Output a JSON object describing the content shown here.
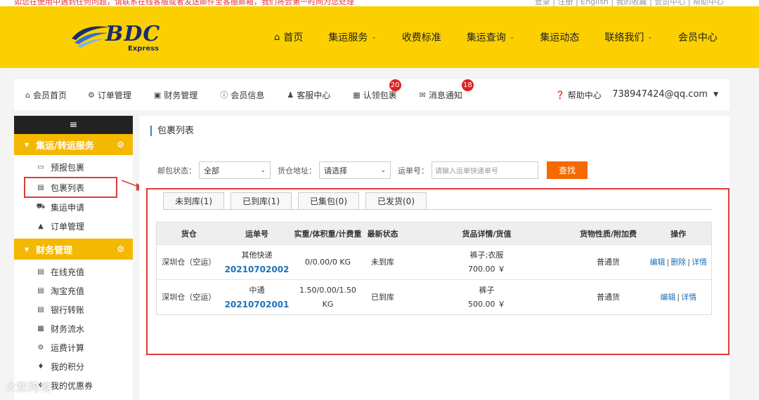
{
  "top_strip": {
    "left_text": "如您在使用中遇到任何问题，请联系在线客服或者发送邮件至客服邮箱，我们将会第一时间为您处理",
    "right_text": "登录 | 注册 | English | 我的收藏 | 会员中心 | 帮助中心"
  },
  "header": {
    "logo_text": "BDC",
    "logo_sub": "Express",
    "nav": [
      {
        "label": "首页",
        "has_menu": false
      },
      {
        "label": "集运服务",
        "has_menu": true
      },
      {
        "label": "收费标准",
        "has_menu": false
      },
      {
        "label": "集运查询",
        "has_menu": true
      },
      {
        "label": "集运动态",
        "has_menu": false
      },
      {
        "label": "联络我们",
        "has_menu": true
      },
      {
        "label": "会员中心",
        "has_menu": false
      }
    ]
  },
  "member_nav": {
    "items": [
      {
        "label": "会员首页",
        "icon": "home-icon"
      },
      {
        "label": "订单管理",
        "icon": "gear-icon"
      },
      {
        "label": "财务管理",
        "icon": "money-icon"
      },
      {
        "label": "会员信息",
        "icon": "info-icon"
      },
      {
        "label": "客服中心",
        "icon": "user-icon"
      },
      {
        "label": "认领包裹",
        "icon": "package-icon",
        "badge": "20"
      },
      {
        "label": "消息通知",
        "icon": "mail-icon",
        "badge": "18"
      }
    ],
    "help": "帮助中心",
    "user": "738947424@qq.com"
  },
  "sidebar": {
    "toggle": "≡",
    "groups": [
      {
        "title": "集运/转运服务",
        "items": [
          {
            "label": "预报包裹",
            "icon": "forecast-icon"
          },
          {
            "label": "包裹列表",
            "icon": "list-icon",
            "active": true
          },
          {
            "label": "集运申请",
            "icon": "truck-icon"
          },
          {
            "label": "订单管理",
            "icon": "book-icon"
          }
        ]
      },
      {
        "title": "财务管理",
        "items": [
          {
            "label": "在线充值",
            "icon": "list-icon"
          },
          {
            "label": "淘宝充值",
            "icon": "card-icon"
          },
          {
            "label": "银行转账",
            "icon": "card-icon"
          },
          {
            "label": "财务流水",
            "icon": "chart-icon"
          },
          {
            "label": "运费计算",
            "icon": "gears-icon"
          },
          {
            "label": "我的积分",
            "icon": "gift-icon"
          },
          {
            "label": "我的优惠券",
            "icon": "gift-icon"
          }
        ]
      }
    ]
  },
  "main": {
    "title": "包裹列表",
    "filters": {
      "status_label": "邮包状态：",
      "status_value": "全部",
      "warehouse_label": "货仓地址：",
      "warehouse_value": "请选择",
      "waybill_label": "运单号：",
      "waybill_placeholder": "请输入运单快递单号",
      "search_button": "查找"
    },
    "tabs": [
      "未到库(1)",
      "已到库(1)",
      "已集包(0)",
      "已发货(0)"
    ],
    "table": {
      "headers": [
        "货仓",
        "运单号",
        "实重/体积重/计费重",
        "最新状态",
        "货品详情/货值",
        "货物性质/附加费",
        "操作"
      ],
      "rows": [
        {
          "warehouse": "深圳仓（空运）",
          "carrier": "其他快递",
          "waybill": "20210702002",
          "weight": "0/0.00/0 KG",
          "status": "未到库",
          "goods": "裤子;衣服",
          "value": "700.00 ￥",
          "nature": "普通货",
          "actions": [
            "编辑",
            "删除",
            "详情"
          ]
        },
        {
          "warehouse": "深圳仓（空运）",
          "carrier": "中通",
          "waybill": "20210702001",
          "weight": "1.50/0.00/1.50 KG",
          "status": "已到库",
          "goods": "裤子",
          "value": "500.00 ￥",
          "nature": "普通货",
          "actions": [
            "编辑",
            "详情"
          ]
        }
      ]
    }
  },
  "watermark": "大数跨境",
  "colors": {
    "header_yellow": "#fcd000",
    "sidebar_group": "#f5b800",
    "search_button": "#f56a00",
    "link_blue": "#1d72b8",
    "badge_red": "#e02020",
    "highlight_red": "#e03a3a"
  }
}
